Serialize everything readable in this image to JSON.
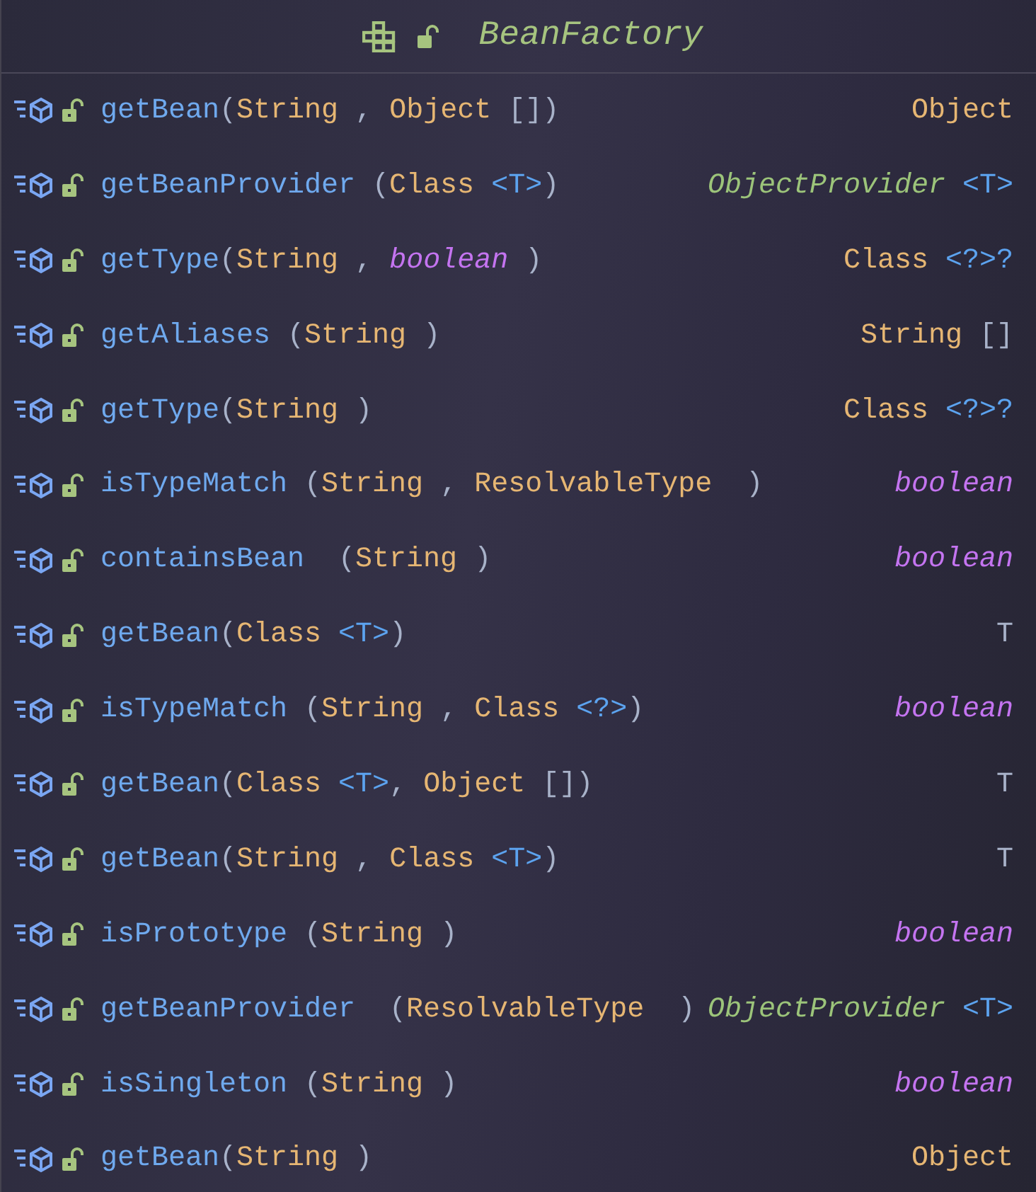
{
  "header": {
    "title": "BeanFactory"
  },
  "methods": [
    {
      "name": "getBean",
      "params": [
        {
          "text": "(",
          "kind": "punct"
        },
        {
          "text": "String",
          "kind": "class"
        },
        {
          "text": " , ",
          "kind": "punct"
        },
        {
          "text": "Object",
          "kind": "class"
        },
        {
          "text": " [])",
          "kind": "punct"
        }
      ],
      "returns": [
        {
          "text": "Object",
          "kind": "class"
        }
      ]
    },
    {
      "name": "getBeanProvider",
      "params": [
        {
          "text": " (",
          "kind": "punct"
        },
        {
          "text": "Class",
          "kind": "class"
        },
        {
          "text": " <T>",
          "kind": "generic"
        },
        {
          "text": ")",
          "kind": "punct"
        }
      ],
      "returns": [
        {
          "text": "ObjectProvider",
          "kind": "interface"
        },
        {
          "text": " <T>",
          "kind": "generic"
        }
      ]
    },
    {
      "name": "getType",
      "params": [
        {
          "text": "(",
          "kind": "punct"
        },
        {
          "text": "String",
          "kind": "class"
        },
        {
          "text": " , ",
          "kind": "punct"
        },
        {
          "text": "boolean",
          "kind": "keyword"
        },
        {
          "text": " )",
          "kind": "punct"
        }
      ],
      "returns": [
        {
          "text": "Class",
          "kind": "class"
        },
        {
          "text": " <?>?",
          "kind": "generic"
        }
      ]
    },
    {
      "name": "getAliases",
      "params": [
        {
          "text": " (",
          "kind": "punct"
        },
        {
          "text": "String",
          "kind": "class"
        },
        {
          "text": " )",
          "kind": "punct"
        }
      ],
      "returns": [
        {
          "text": "String",
          "kind": "class"
        },
        {
          "text": " []",
          "kind": "punct"
        }
      ]
    },
    {
      "name": "getType",
      "params": [
        {
          "text": "(",
          "kind": "punct"
        },
        {
          "text": "String",
          "kind": "class"
        },
        {
          "text": " )",
          "kind": "punct"
        }
      ],
      "returns": [
        {
          "text": "Class",
          "kind": "class"
        },
        {
          "text": " <?>?",
          "kind": "generic"
        }
      ]
    },
    {
      "name": "isTypeMatch",
      "params": [
        {
          "text": " (",
          "kind": "punct"
        },
        {
          "text": "String",
          "kind": "class"
        },
        {
          "text": " , ",
          "kind": "punct"
        },
        {
          "text": "ResolvableType",
          "kind": "class"
        },
        {
          "text": "  )",
          "kind": "punct"
        }
      ],
      "returns": [
        {
          "text": "boolean",
          "kind": "keyword"
        }
      ]
    },
    {
      "name": "containsBean",
      "params": [
        {
          "text": "  (",
          "kind": "punct"
        },
        {
          "text": "String",
          "kind": "class"
        },
        {
          "text": " )",
          "kind": "punct"
        }
      ],
      "returns": [
        {
          "text": "boolean",
          "kind": "keyword"
        }
      ]
    },
    {
      "name": "getBean",
      "params": [
        {
          "text": "(",
          "kind": "punct"
        },
        {
          "text": "Class",
          "kind": "class"
        },
        {
          "text": " <T>",
          "kind": "generic"
        },
        {
          "text": ")",
          "kind": "punct"
        }
      ],
      "returns": [
        {
          "text": "T",
          "kind": "punct"
        }
      ]
    },
    {
      "name": "isTypeMatch",
      "params": [
        {
          "text": " (",
          "kind": "punct"
        },
        {
          "text": "String",
          "kind": "class"
        },
        {
          "text": " , ",
          "kind": "punct"
        },
        {
          "text": "Class",
          "kind": "class"
        },
        {
          "text": " <?>",
          "kind": "generic"
        },
        {
          "text": ")",
          "kind": "punct"
        }
      ],
      "returns": [
        {
          "text": "boolean",
          "kind": "keyword"
        }
      ]
    },
    {
      "name": "getBean",
      "params": [
        {
          "text": "(",
          "kind": "punct"
        },
        {
          "text": "Class",
          "kind": "class"
        },
        {
          "text": " <T>",
          "kind": "generic"
        },
        {
          "text": ", ",
          "kind": "punct"
        },
        {
          "text": "Object",
          "kind": "class"
        },
        {
          "text": " [])",
          "kind": "punct"
        }
      ],
      "returns": [
        {
          "text": "T",
          "kind": "punct"
        }
      ]
    },
    {
      "name": "getBean",
      "params": [
        {
          "text": "(",
          "kind": "punct"
        },
        {
          "text": "String",
          "kind": "class"
        },
        {
          "text": " , ",
          "kind": "punct"
        },
        {
          "text": "Class",
          "kind": "class"
        },
        {
          "text": " <T>",
          "kind": "generic"
        },
        {
          "text": ")",
          "kind": "punct"
        }
      ],
      "returns": [
        {
          "text": "T",
          "kind": "punct"
        }
      ]
    },
    {
      "name": "isPrototype",
      "params": [
        {
          "text": " (",
          "kind": "punct"
        },
        {
          "text": "String",
          "kind": "class"
        },
        {
          "text": " )",
          "kind": "punct"
        }
      ],
      "returns": [
        {
          "text": "boolean",
          "kind": "keyword"
        }
      ]
    },
    {
      "name": "getBeanProvider",
      "params": [
        {
          "text": "  (",
          "kind": "punct"
        },
        {
          "text": "ResolvableType",
          "kind": "class"
        },
        {
          "text": "  )",
          "kind": "punct"
        }
      ],
      "returns": [
        {
          "text": "ObjectProvider",
          "kind": "interface"
        },
        {
          "text": " <T>",
          "kind": "generic"
        }
      ]
    },
    {
      "name": "isSingleton",
      "params": [
        {
          "text": " (",
          "kind": "punct"
        },
        {
          "text": "String",
          "kind": "class"
        },
        {
          "text": " )",
          "kind": "punct"
        }
      ],
      "returns": [
        {
          "text": "boolean",
          "kind": "keyword"
        }
      ]
    },
    {
      "name": "getBean",
      "params": [
        {
          "text": "(",
          "kind": "punct"
        },
        {
          "text": "String",
          "kind": "class"
        },
        {
          "text": " )",
          "kind": "punct"
        }
      ],
      "returns": [
        {
          "text": "Object",
          "kind": "class"
        }
      ]
    }
  ]
}
